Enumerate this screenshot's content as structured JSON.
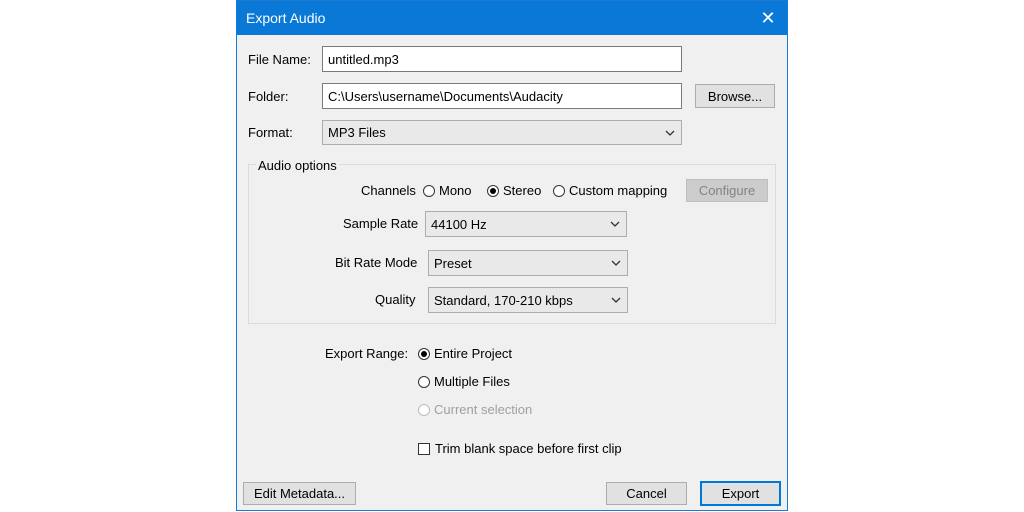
{
  "window": {
    "title": "Export Audio"
  },
  "file_name": {
    "label": "File Name:",
    "value": "untitled.mp3"
  },
  "folder": {
    "label": "Folder:",
    "value": "C:\\Users\\username\\Documents\\Audacity",
    "browse_label": "Browse..."
  },
  "format": {
    "label": "Format:",
    "value": "MP3 Files"
  },
  "audio_options": {
    "title": "Audio options",
    "channels": {
      "label": "Channels",
      "options": [
        {
          "label": "Mono",
          "selected": false
        },
        {
          "label": "Stereo",
          "selected": true
        },
        {
          "label": "Custom mapping",
          "selected": false
        }
      ],
      "configure_label": "Configure"
    },
    "sample_rate": {
      "label": "Sample Rate",
      "value": "44100 Hz"
    },
    "bit_rate_mode": {
      "label": "Bit Rate Mode",
      "value": "Preset"
    },
    "quality": {
      "label": "Quality",
      "value": "Standard, 170-210 kbps"
    }
  },
  "export_range": {
    "label": "Export Range:",
    "options": [
      {
        "label": "Entire Project",
        "selected": true,
        "enabled": true
      },
      {
        "label": "Multiple Files",
        "selected": false,
        "enabled": true
      },
      {
        "label": "Current selection",
        "selected": false,
        "enabled": false
      }
    ]
  },
  "trim": {
    "label": "Trim blank space before first clip",
    "checked": false
  },
  "buttons": {
    "edit_metadata": "Edit Metadata...",
    "cancel": "Cancel",
    "export": "Export"
  }
}
